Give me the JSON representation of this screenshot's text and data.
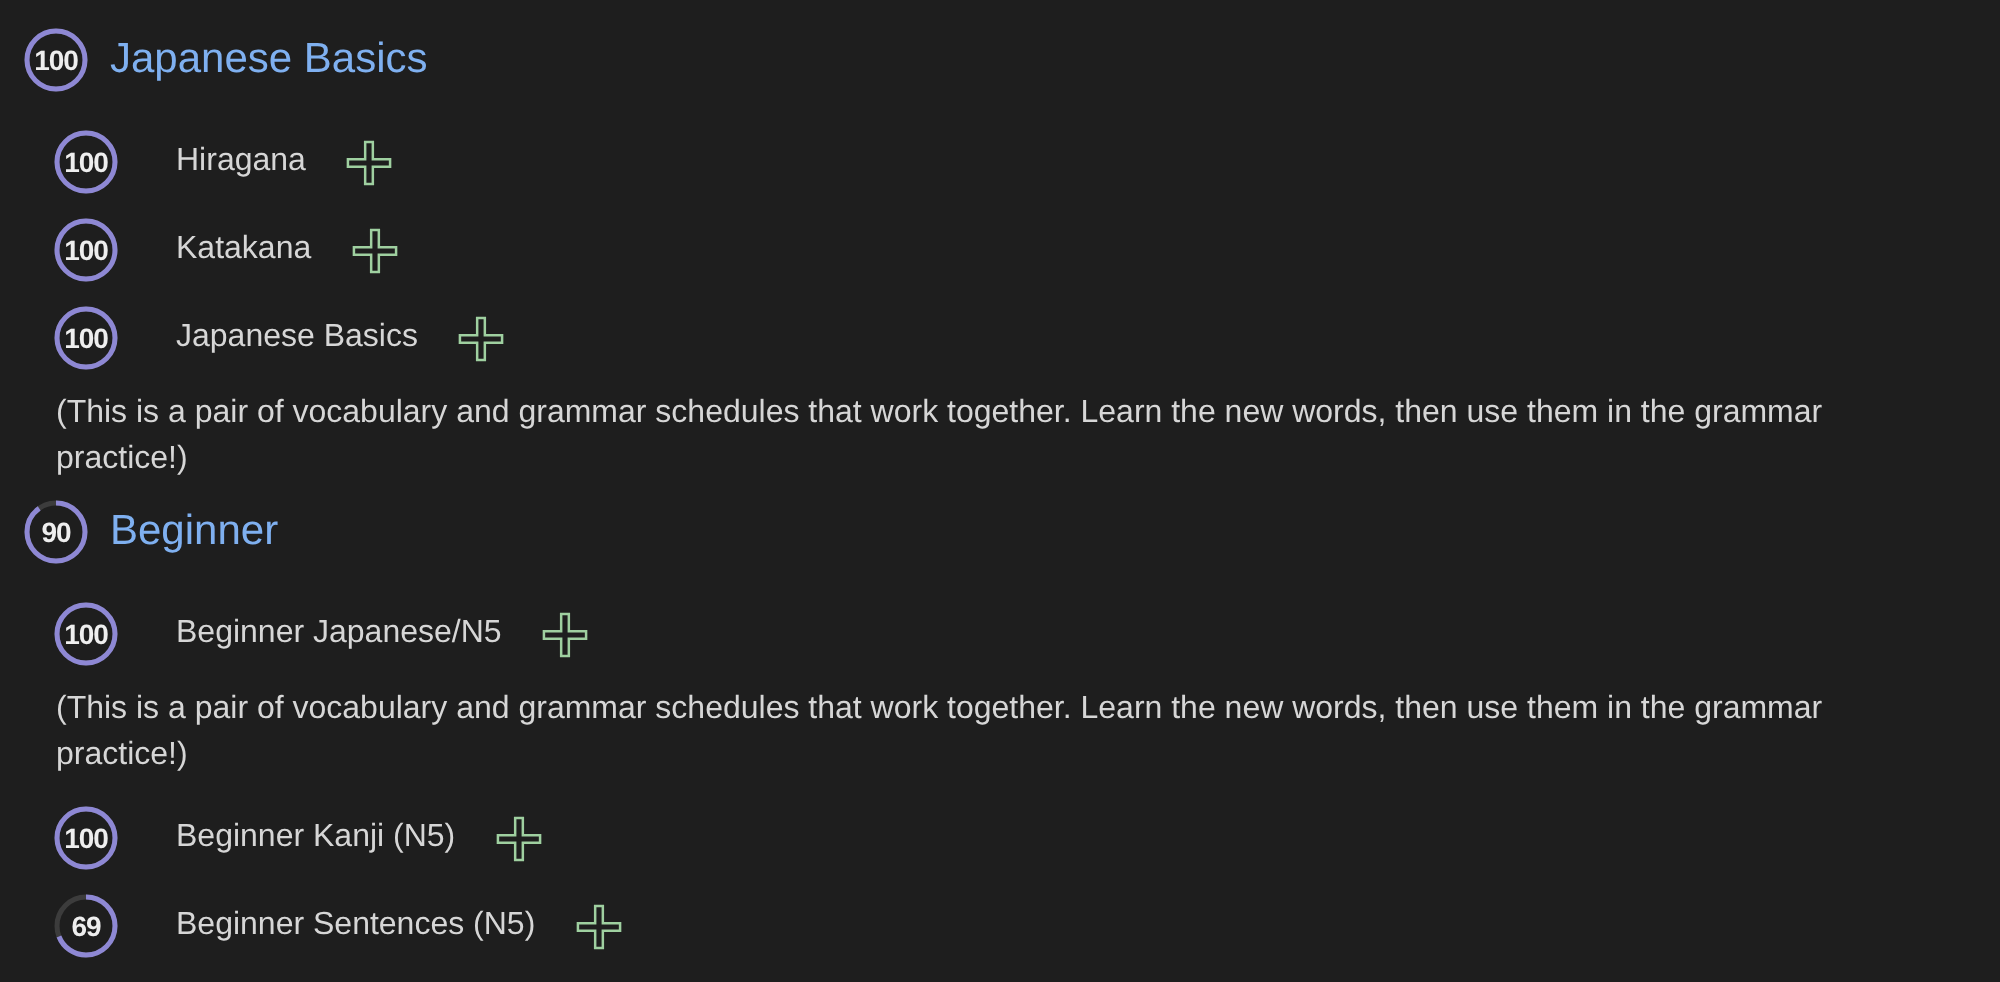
{
  "sections": [
    {
      "title": "Japanese Basics",
      "score": "100",
      "level": 1,
      "items": [
        {
          "kind": "course",
          "label": "Hiragana",
          "score": "100",
          "level": 1
        },
        {
          "kind": "course",
          "label": "Katakana",
          "score": "100",
          "level": 1
        },
        {
          "kind": "course",
          "label": "Japanese Basics",
          "score": "100",
          "level": 1
        },
        {
          "kind": "note",
          "text": "(This is a pair of vocabulary and grammar schedules that work together. Learn the new words, then use them in the grammar practice!)"
        }
      ]
    },
    {
      "title": "Beginner",
      "score": "90",
      "level": 0.9,
      "items": [
        {
          "kind": "course",
          "label": "Beginner Japanese/N5",
          "score": "100",
          "level": 1
        },
        {
          "kind": "note",
          "text": "(This is a pair of vocabulary and grammar schedules that work together. Learn the new words, then use them in the grammar practice!)"
        },
        {
          "kind": "course",
          "label": "Beginner Kanji (N5)",
          "score": "100",
          "level": 1
        },
        {
          "kind": "course",
          "label": "Beginner Sentences (N5)",
          "score": "69",
          "level": 0.69
        }
      ]
    }
  ]
}
